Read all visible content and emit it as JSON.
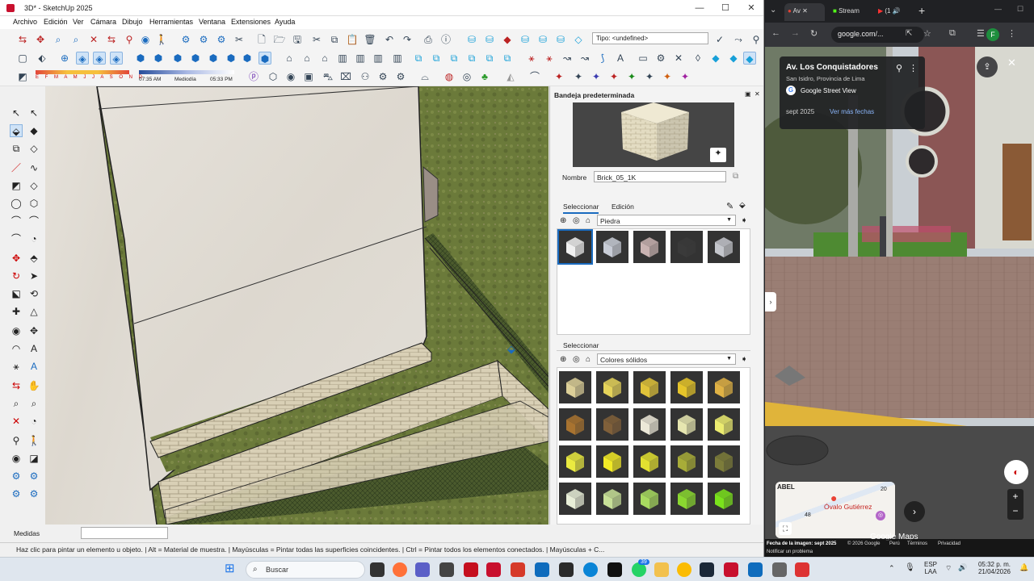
{
  "sketchup": {
    "window_title": "3D* - SketchUp 2025",
    "window_controls": {
      "minimize": "—",
      "maximize": "☐",
      "close": "✕"
    },
    "menu": [
      "Archivo",
      "Edición",
      "Ver",
      "Cámara",
      "Dibujo",
      "Herramientas",
      "Ventana",
      "Extensiones",
      "Ayuda"
    ],
    "tipo_field": "Tipo: <undefined>",
    "shadow_months": "E F M A M J J A S O N D",
    "shadow_time_start": "07:35 AM",
    "shadow_time_mid": "Mediodía",
    "shadow_time_end": "05:33 PM",
    "tray": {
      "title": "Bandeja predeterminada",
      "name_label": "Nombre",
      "name_value": "Brick_05_1K",
      "tab_select": "Seleccionar",
      "tab_edit": "Edición",
      "library_1": "Piedra",
      "second_panel_title": "Seleccionar",
      "library_2": "Colores sólidos",
      "stone_swatches": [
        "#f0f0f0",
        "#c8ccd6",
        "#c9b3b2",
        "#3a3a3a",
        "#c4c6cc"
      ],
      "solid_colors": [
        [
          "#dccf98",
          "#e5d35a",
          "#e0c33a",
          "#e6c52a",
          "#e0b245"
        ],
        [
          "#a87330",
          "#80603a",
          "#ece8d8",
          "#e6e6b0",
          "#ecec70"
        ],
        [
          "#eaea40",
          "#f2ea26",
          "#e2e030",
          "#a8ac38",
          "#7c7c3a"
        ],
        [
          "#e8eed8",
          "#c8e098",
          "#a8da60",
          "#8ad830",
          "#7ae21c"
        ]
      ]
    },
    "measures_label": "Medidas",
    "status_text": "Haz clic para pintar un elemento u objeto. | Alt = Material de muestra. | Mayúsculas = Pintar todas las superficies coincidentes. | Ctrl = Pintar todos los elementos conectados. | Mayúsculas + C..."
  },
  "chrome": {
    "tab1_label": "Av",
    "tab2_label": "Stream",
    "tab3_label": "(1",
    "new_tab": "+",
    "url": "google.com/...",
    "profile_initial": "F",
    "street_view": {
      "place": "Av. Los Conquistadores",
      "subtitle": "San Isidro, Provincia de Lima",
      "brand": "Google Street View",
      "date": "sept 2025",
      "more_dates": "Ver más fechas",
      "map_label_top": "ABEL",
      "map_label_pin": "Óvalo Gutiérrez",
      "map_num_1": "20",
      "map_num_2": "48",
      "watermark": "Google Maps",
      "footer_left": "Fecha de la imagen: sept 2025",
      "footer_copyright": "© 2026 Google",
      "footer_country": "Perú",
      "footer_terms": "Términos",
      "footer_privacy": "Privacidad",
      "footer_report": "Notificar un problema"
    }
  },
  "taskbar": {
    "search": "Buscar",
    "lang": "ESP",
    "lang2": "LAA",
    "time": "05:32 p. m.",
    "date": "21/04/2026",
    "badge": "39"
  }
}
